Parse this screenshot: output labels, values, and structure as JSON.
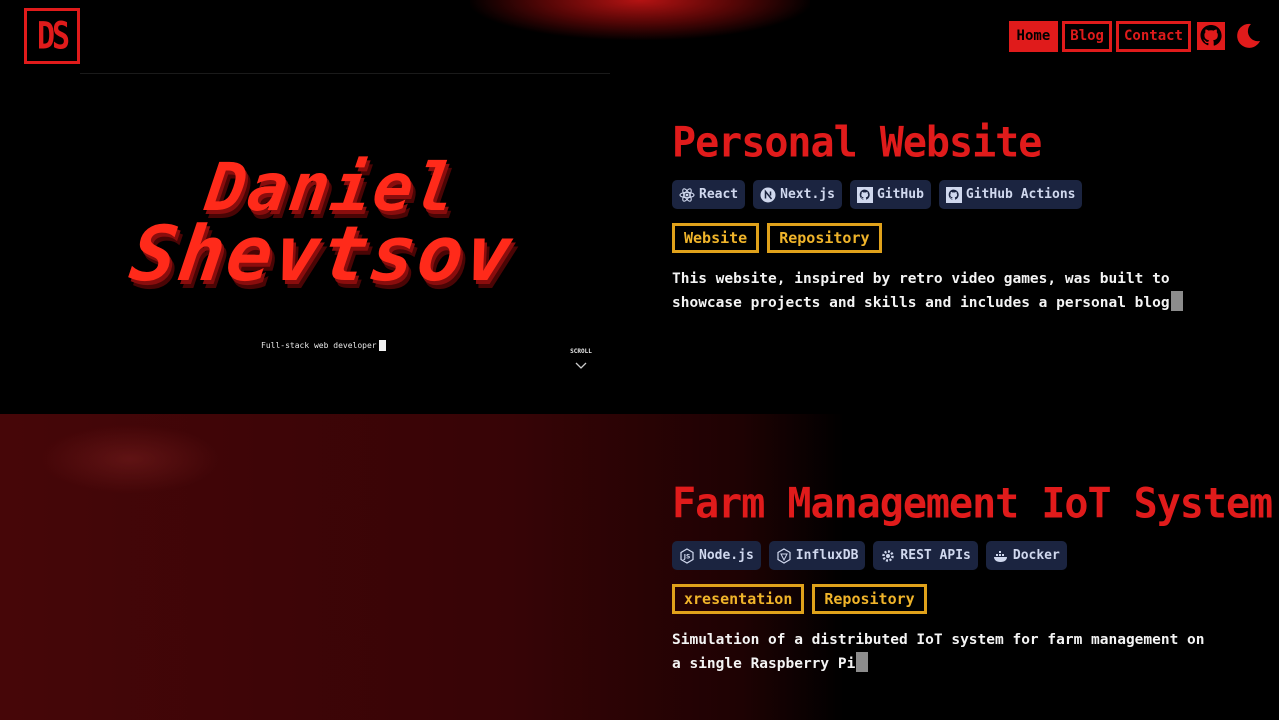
{
  "logo": {
    "text": "DS"
  },
  "nav": {
    "links": [
      {
        "label": "Home",
        "active": true
      },
      {
        "label": "Blog",
        "active": false
      },
      {
        "label": "Contact",
        "active": false
      }
    ],
    "icons": [
      "github-icon",
      "moon-icon"
    ]
  },
  "hero_preview": {
    "name_line1": "Daniel",
    "name_line2": "Shevtsov",
    "subtitle": "Full-stack web developer",
    "scroll_label": "SCROLL"
  },
  "projects": [
    {
      "title": "Personal Website",
      "tags": [
        {
          "label": "React",
          "icon": "react-icon"
        },
        {
          "label": "Next.js",
          "icon": "nextjs-icon"
        },
        {
          "label": "GitHub",
          "icon": "github-icon"
        },
        {
          "label": "GitHub Actions",
          "icon": "github-icon"
        }
      ],
      "links": [
        "Website",
        "Repository"
      ],
      "description_line1": "This website, inspired by retro video games, was built to",
      "description_line2": "showcase projects and skills and includes a personal blog"
    },
    {
      "title": "Farm Management IoT System",
      "tags": [
        {
          "label": "Node.js",
          "icon": "nodejs-icon"
        },
        {
          "label": "InfluxDB",
          "icon": "influxdb-icon"
        },
        {
          "label": "REST APIs",
          "icon": "gear-icon"
        },
        {
          "label": "Docker",
          "icon": "docker-icon"
        }
      ],
      "links": [
        "xresentation",
        "Repository"
      ],
      "description_line1": "Simulation of a distributed IoT system for farm management on",
      "description_line2": "a single Raspberry Pi"
    }
  ],
  "colors": {
    "accent": "#e01b1b",
    "gold": "#e0a21b",
    "tag_bg": "#1b2440"
  }
}
